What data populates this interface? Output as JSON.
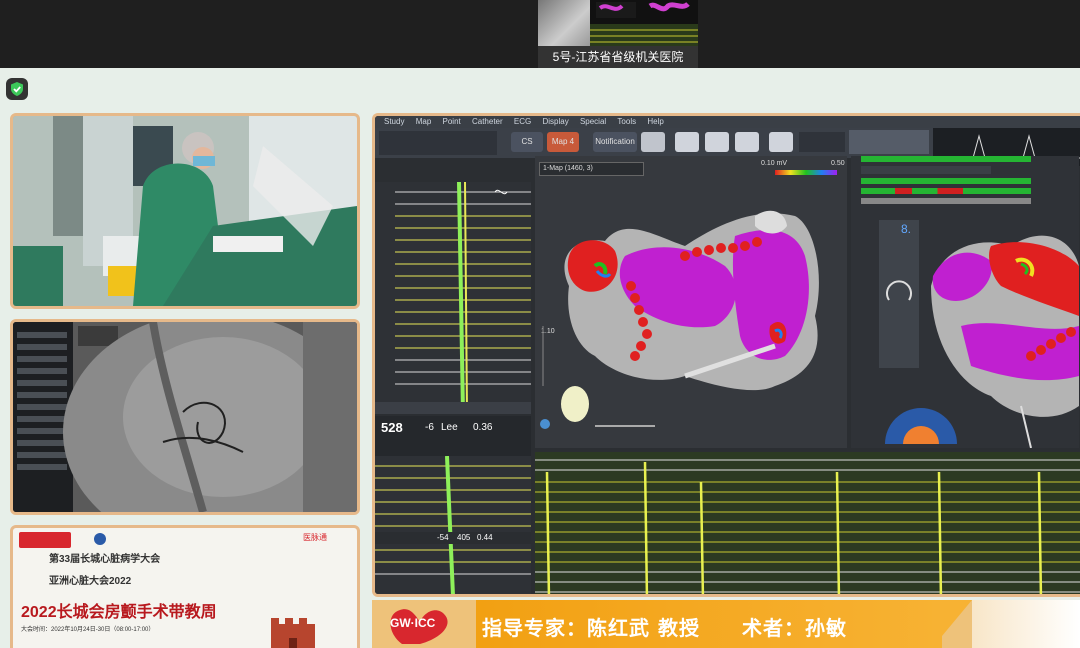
{
  "top_thumbnail": {
    "caption": "5号-江苏省省级机关医院"
  },
  "ep_system": {
    "menu": [
      "Study",
      "Map",
      "Point",
      "Catheter",
      "ECG",
      "Display",
      "Special",
      "Tools",
      "Help"
    ],
    "buttons": {
      "b1": "CS",
      "b2": "Map 4",
      "b3": "Notification"
    },
    "map_selector": "1-Map (1460, 3)",
    "voltage_scale": {
      "low": "0.10 mV",
      "high": "0.50"
    },
    "cycle_length": "528",
    "readouts": {
      "r1": "-6",
      "r2": "Lee",
      "r3": "0.36"
    },
    "values_row": {
      "v1": "-54",
      "v2": "405",
      "v3": "0.44"
    },
    "scale_top": "1.10",
    "side_number": "8."
  },
  "poster": {
    "cn_title_1": "第33届长城心脏病学大会",
    "cn_title_2": "亚洲心脏大会2022",
    "headline": "2022长城会房颤手术带教周",
    "date_line": "大会时间：2022年10月24日-30日（08:00-17:00）",
    "brand": "医脉通"
  },
  "banner": {
    "logo_text": "GW·ICC",
    "text": "指导专家：陈红武 教授　　术者：孙敏"
  },
  "colors": {
    "frame": "#e6b98a",
    "banner_orange": "#f2a012",
    "stage_bg": "#e7efe9"
  }
}
